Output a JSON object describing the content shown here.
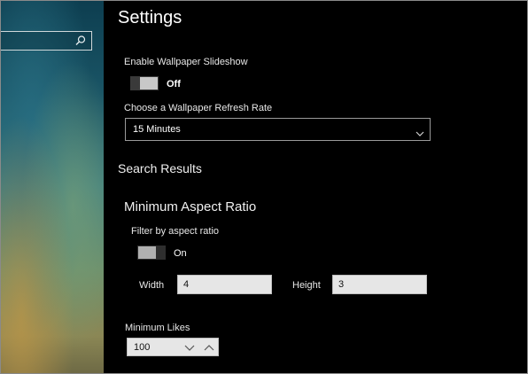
{
  "settings": {
    "title": "Settings",
    "slideshow": {
      "label": "Enable Wallpaper Slideshow",
      "state": "Off"
    },
    "refresh_rate": {
      "label": "Choose a Wallpaper Refresh Rate",
      "selected": "15 Minutes"
    },
    "search_results": {
      "heading": "Search Results",
      "aspect_ratio": {
        "heading": "Minimum Aspect Ratio",
        "filter_label": "Filter by aspect ratio",
        "filter_state": "On",
        "width_label": "Width",
        "width_value": "4",
        "height_label": "Height",
        "height_value": "3"
      },
      "min_likes": {
        "label": "Minimum Likes",
        "value": "100"
      }
    }
  },
  "icons": {
    "search": "search-icon",
    "dropdown": "chevron-down-icon",
    "spin_down": "chevron-down-icon",
    "spin_up": "chevron-up-icon"
  },
  "colors": {
    "background": "#000000",
    "toggle_knob": "#c8c8c8",
    "input_fill": "#e6e6e6"
  }
}
